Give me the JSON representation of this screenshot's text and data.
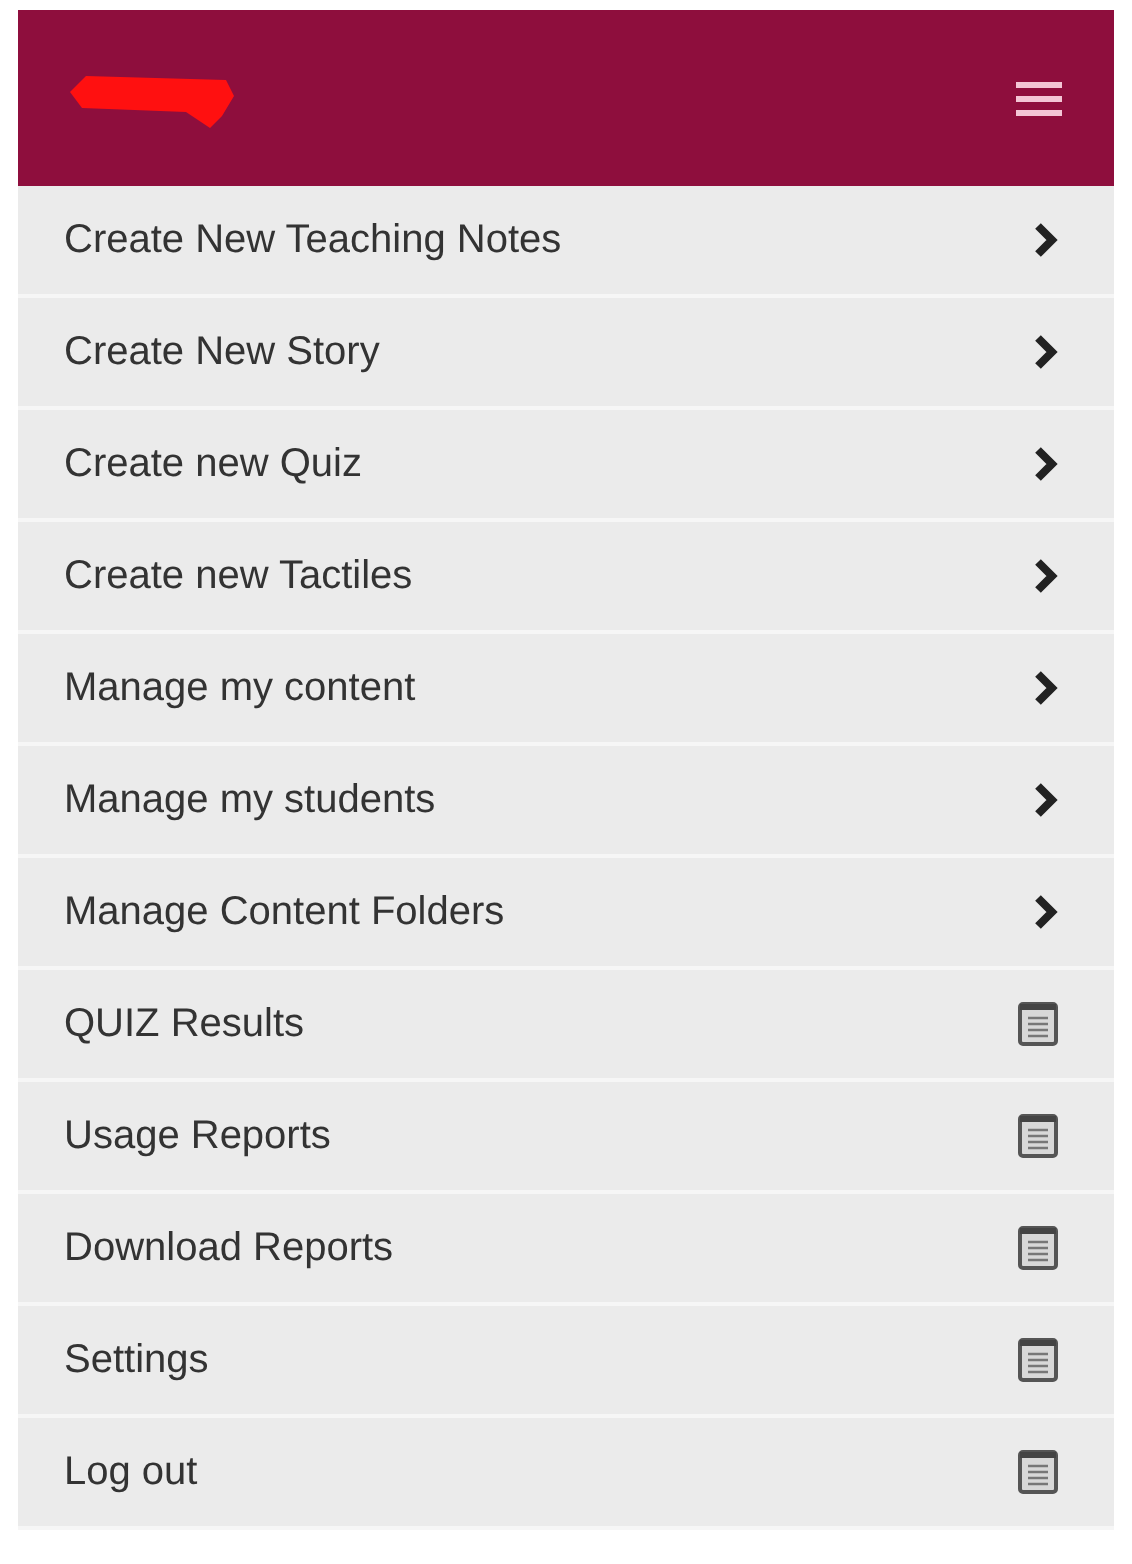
{
  "menu": {
    "items": [
      {
        "label": "Create New Teaching Notes",
        "kind": "submenu"
      },
      {
        "label": "Create New Story",
        "kind": "submenu"
      },
      {
        "label": "Create new Quiz",
        "kind": "submenu"
      },
      {
        "label": "Create new Tactiles",
        "kind": "submenu"
      },
      {
        "label": "Manage my content",
        "kind": "submenu"
      },
      {
        "label": "Manage my students",
        "kind": "submenu"
      },
      {
        "label": "Manage Content Folders",
        "kind": "submenu"
      },
      {
        "label": "QUIZ Results",
        "kind": "page"
      },
      {
        "label": "Usage Reports",
        "kind": "page"
      },
      {
        "label": "Download Reports",
        "kind": "page"
      },
      {
        "label": "Settings",
        "kind": "page"
      },
      {
        "label": "Log out",
        "kind": "page"
      }
    ]
  }
}
